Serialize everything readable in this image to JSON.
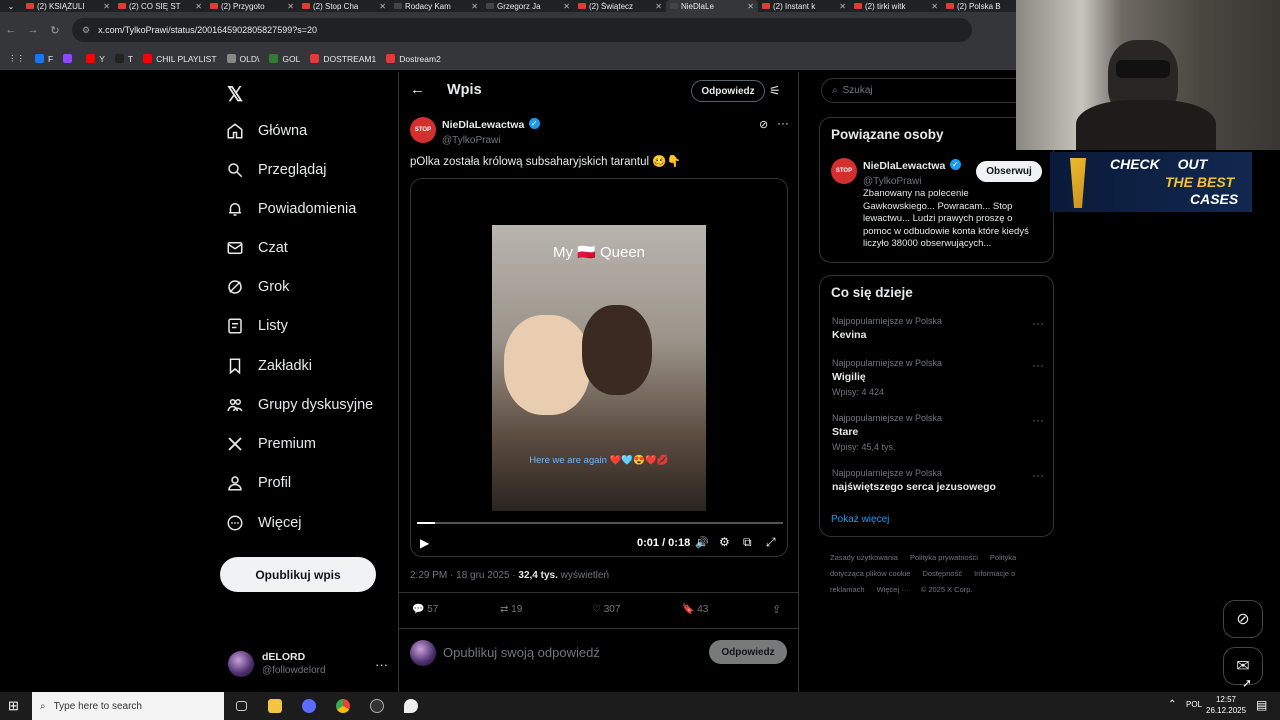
{
  "browser": {
    "tabs": [
      {
        "label": "(2) KSIĄŻULI",
        "color": "#e53935"
      },
      {
        "label": "(2) CO SIĘ ST",
        "color": "#e53935"
      },
      {
        "label": "(2) Przygoto",
        "color": "#e53935"
      },
      {
        "label": "(2) Stop Cha",
        "color": "#e53935"
      },
      {
        "label": "Rodacy Kam",
        "color": "#444"
      },
      {
        "label": "Grzegorz Ja",
        "color": "#444"
      },
      {
        "label": "(2) Świątecz",
        "color": "#e53935"
      },
      {
        "label": "NieDlaLe",
        "color": "#444",
        "active": true
      },
      {
        "label": "(2) Instant k",
        "color": "#e53935"
      },
      {
        "label": "(2) tirki witk",
        "color": "#e53935"
      },
      {
        "label": "(2) Polska B",
        "color": "#e53935"
      }
    ],
    "url": "x.com/TylkoPrawi/status/2001645902805827599?s=20",
    "bookmarks": [
      {
        "label": "F",
        "color": "#1877f2"
      },
      {
        "label": "",
        "color": "#9146ff"
      },
      {
        "label": "Y",
        "color": "#ff0000"
      },
      {
        "label": "T",
        "color": "#222"
      },
      {
        "label": "CHIL PLAYLIST",
        "color": "#ff0000"
      },
      {
        "label": "OLD\\",
        "color": "#888"
      },
      {
        "label": "GOL",
        "color": "#2e7d32"
      },
      {
        "label": "DOSTREAM1",
        "color": "#e53935"
      },
      {
        "label": "Dostream2",
        "color": "#e53935"
      }
    ]
  },
  "nav": {
    "items": [
      {
        "label": "Główna",
        "icon": "home-icon"
      },
      {
        "label": "Przeglądaj",
        "icon": "search-icon"
      },
      {
        "label": "Powiadomienia",
        "icon": "bell-icon"
      },
      {
        "label": "Czat",
        "icon": "mail-icon"
      },
      {
        "label": "Grok",
        "icon": "grok-icon"
      },
      {
        "label": "Listy",
        "icon": "list-icon"
      },
      {
        "label": "Zakładki",
        "icon": "bookmark-icon"
      },
      {
        "label": "Grupy dyskusyjne",
        "icon": "people-icon"
      },
      {
        "label": "Premium",
        "icon": "x-icon"
      },
      {
        "label": "Profil",
        "icon": "person-icon"
      },
      {
        "label": "Więcej",
        "icon": "more-circle-icon"
      }
    ],
    "post_button": "Opublikuj wpis",
    "account": {
      "name": "dELORD",
      "handle": "@followdelord"
    }
  },
  "main": {
    "header_title": "Wpis",
    "reply_button": "Odpowiedz",
    "author": {
      "name": "NieDlaLewactwa",
      "handle": "@TylkoPrawi",
      "avatar_text": "STOP"
    },
    "tweet_text": "pOlka została królową subsaharyjskich tarantul 🥴👇",
    "video": {
      "overlay_title": "My 🇵🇱 Queen",
      "caption": "Here we are again ❤️🩵😍❤️💋",
      "time": "0:01 / 0:18",
      "progress": 0.05
    },
    "meta": {
      "time": "2:29 PM · 18 gru 2025 ·",
      "views_count": "32,4 tys.",
      "views_label": "wyświetleń"
    },
    "actions": {
      "replies": "57",
      "reposts": "19",
      "likes": "307",
      "bookmarks": "43"
    },
    "reply_placeholder": "Opublikuj swoją odpowiedź",
    "reply_submit": "Odpowiedz"
  },
  "sidebar": {
    "search_placeholder": "Szukaj",
    "related": {
      "title": "Powiązane osoby",
      "name": "NieDlaLewactwa",
      "handle": "@TylkoPrawi",
      "follow": "Obserwuj",
      "bio": "Zbanowany na polecenie Gawkowskiego... Powracam... Stop lewactwu... Ludzi prawych proszę o pomoc w odbudowie konta które kiedyś liczyło 38000 obserwujących..."
    },
    "trends": {
      "title": "Co się dzieje",
      "items": [
        {
          "category": "Najpopularniejsze w Polska",
          "name": "Kevina",
          "count": ""
        },
        {
          "category": "Najpopularniejsze w Polska",
          "name": "Wigilię",
          "count": "Wpisy: 4 424"
        },
        {
          "category": "Najpopularniejsze w Polska",
          "name": "Stare",
          "count": "Wpisy: 45,4 tys."
        },
        {
          "category": "Najpopularniejsze w Polska",
          "name": "najświętszego serca jezusowego",
          "count": ""
        }
      ],
      "show_more": "Pokaż więcej"
    },
    "footer": [
      "Zasady użytkowania",
      "Polityka prywatności",
      "Polityka dotycząca plików cookie",
      "Dostępność",
      "Informacje o reklamach",
      "Więcej ···",
      "© 2025 X Corp."
    ]
  },
  "overlay": {
    "ad_line1": "CHECK",
    "ad_line2": "OUT",
    "ad_line3": "THE BEST",
    "ad_line4": "CASES"
  },
  "taskbar": {
    "search_placeholder": "Type here to search",
    "lang": "POL",
    "time": "12:57",
    "date": "26.12.2025"
  }
}
